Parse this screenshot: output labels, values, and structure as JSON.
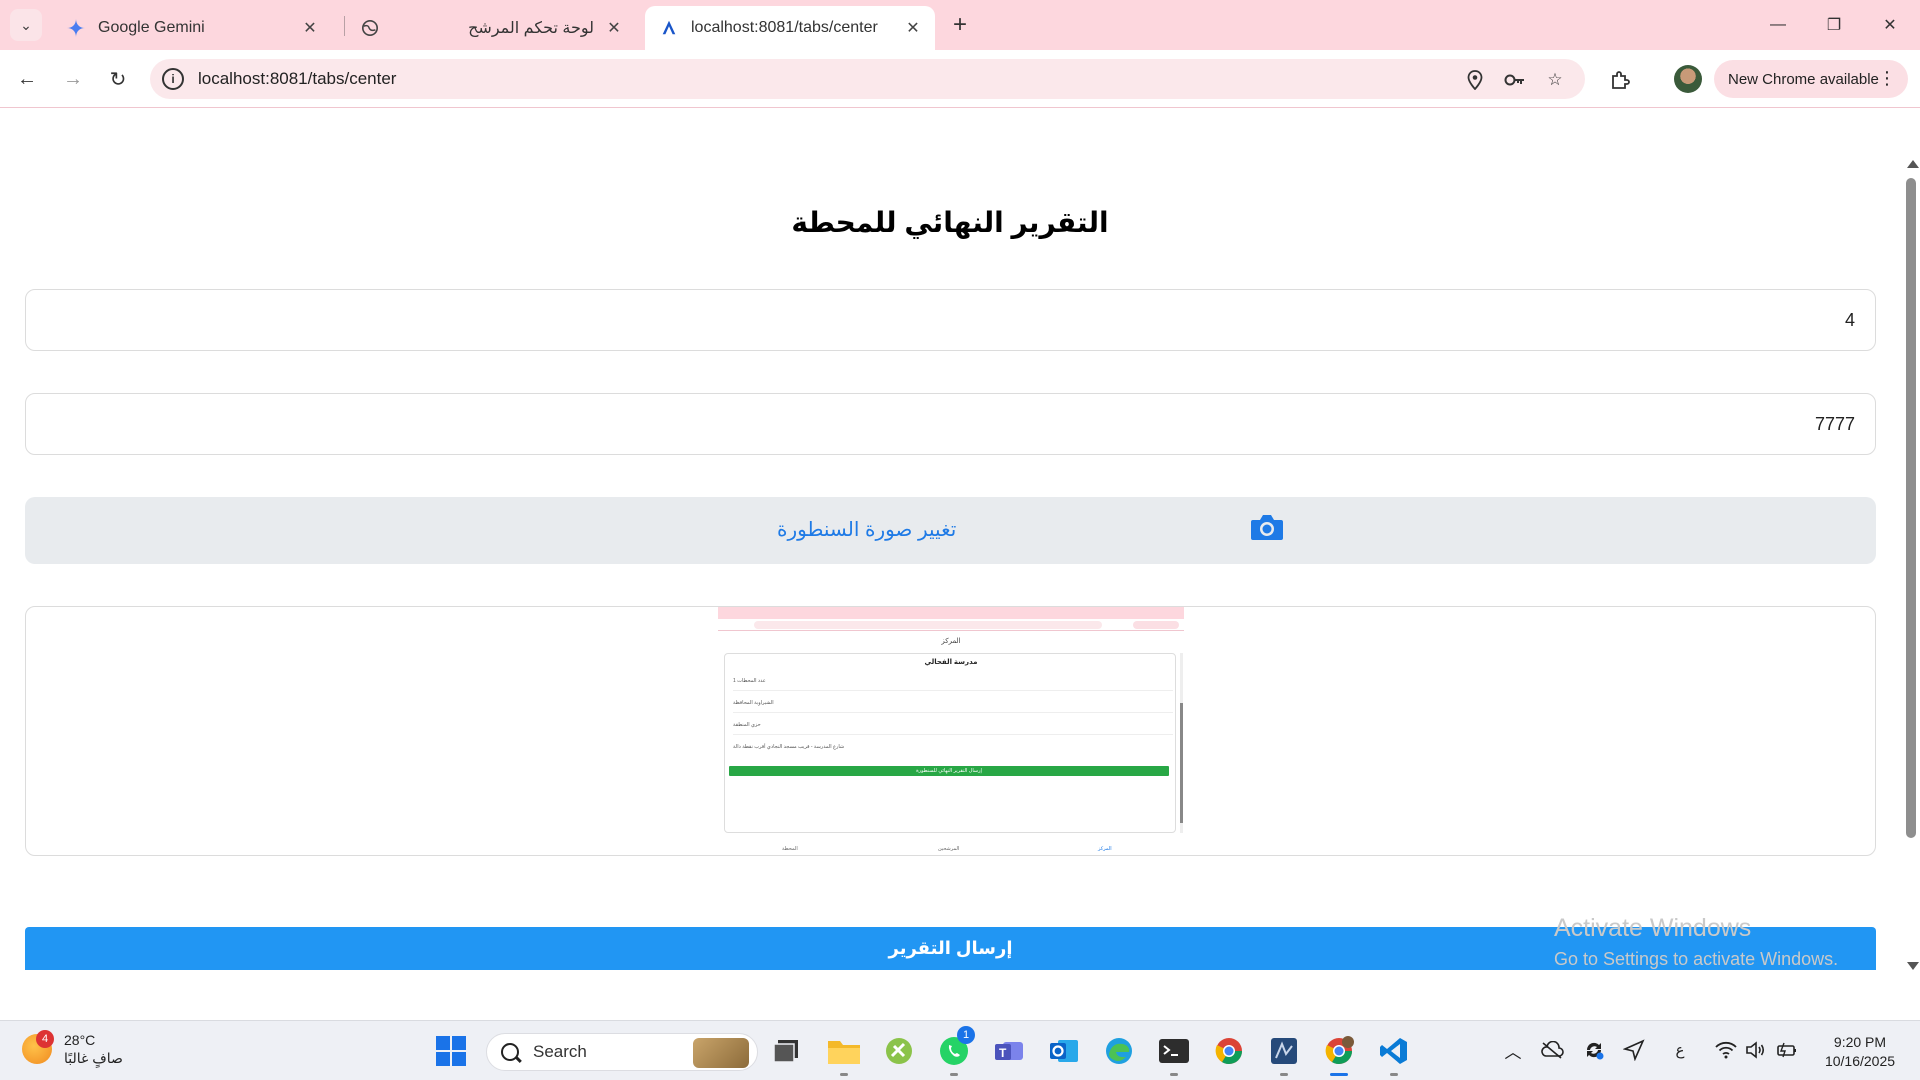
{
  "browser": {
    "tabs": [
      {
        "title": "Google Gemini",
        "active": false
      },
      {
        "title": "لوحة تحكم المرشح",
        "active": false
      },
      {
        "title": "localhost:8081/tabs/center",
        "active": true
      }
    ],
    "url": "localhost:8081/tabs/center",
    "update_label": "New Chrome available"
  },
  "page": {
    "title": "التقرير النهائي للمحطة",
    "field1_value": "4",
    "field2_value": "7777",
    "change_photo_label": "تغيير صورة السنطورة",
    "submit_label": "إرسال التقرير",
    "preview": {
      "top_label": "المركز",
      "card_title": "مدرسة الفحالي",
      "rows": [
        "1  عدد المحطات",
        "الشيراوية  المحافظة",
        "حزي  المنطقة",
        "شارع المدرسة - قريب مسجد النجادي  أقرب نقطة دالة"
      ],
      "button_label": "إرسال التقرير النهائي للسنطورة",
      "nav": [
        "المحطة",
        "المرشحين",
        "المركز"
      ]
    }
  },
  "watermark": {
    "line1": "Activate Windows",
    "line2": "Go to Settings to activate Windows."
  },
  "taskbar": {
    "weather_badge": "4",
    "temperature": "28°C",
    "weather_desc": "صافٍ غالبًا",
    "search_placeholder": "Search",
    "whatsapp_badge": "1",
    "input_lang": "ع",
    "time": "9:20 PM",
    "date": "10/16/2025"
  },
  "colors": {
    "tabstrip": "#fdd7de",
    "accent_blue": "#2196f3",
    "link_blue": "#1e7ae6",
    "green": "#28a745"
  }
}
